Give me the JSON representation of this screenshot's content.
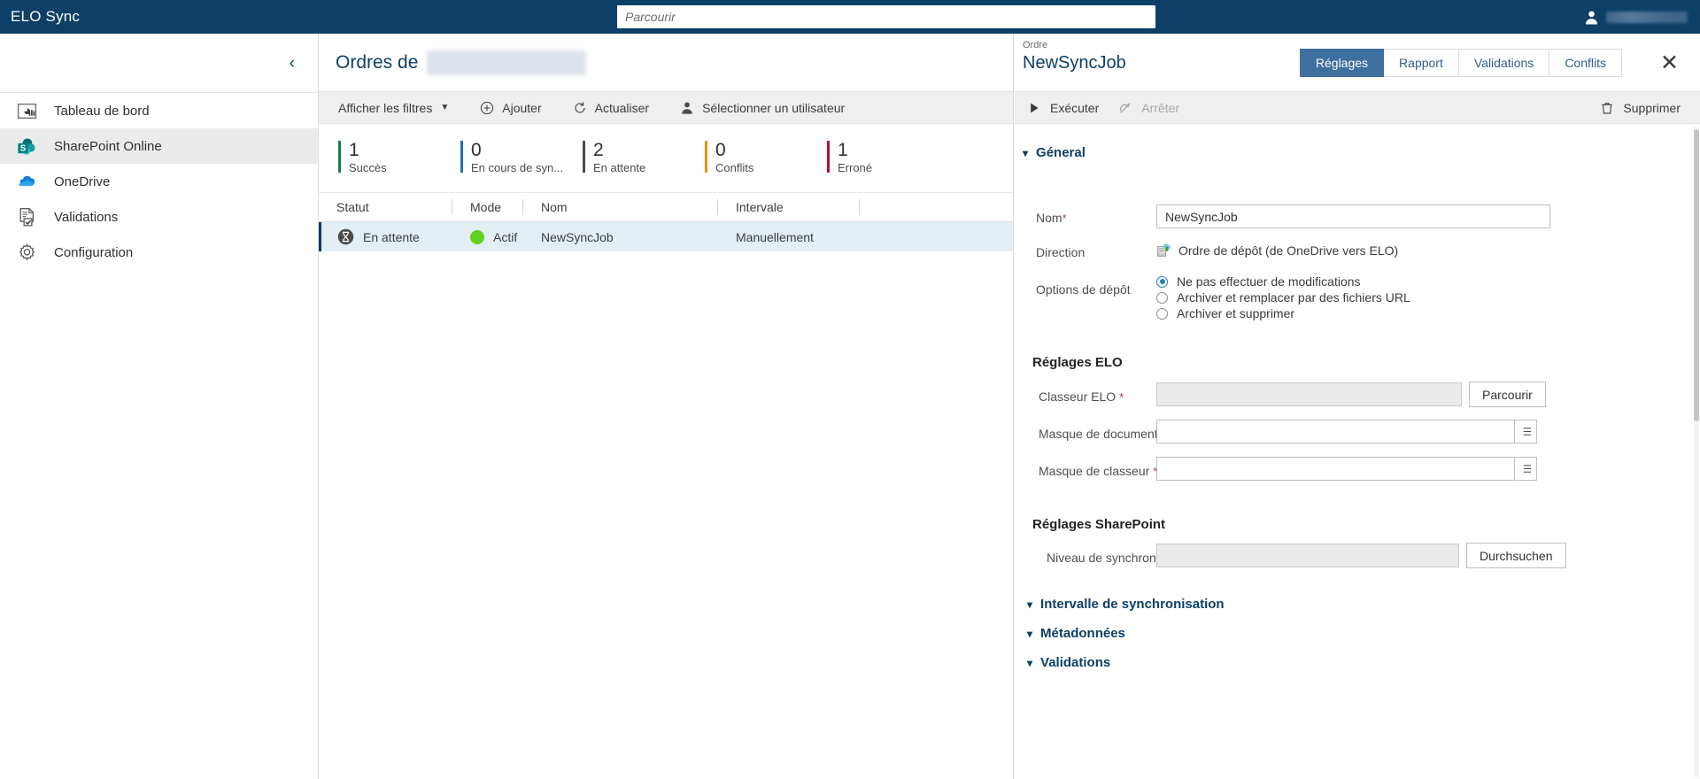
{
  "topbar": {
    "app_title": "ELO Sync",
    "search_placeholder": "Parcourir",
    "search_value": "",
    "user_icon": "user-icon"
  },
  "sidebar": {
    "collapse_icon": "chevron-left-icon",
    "items": [
      {
        "label": "Tableau de bord",
        "icon": "dashboard-icon",
        "active": false
      },
      {
        "label": "SharePoint Online",
        "icon": "sharepoint-icon",
        "active": true
      },
      {
        "label": "OneDrive",
        "icon": "onedrive-icon",
        "active": false
      },
      {
        "label": "Validations",
        "icon": "document-check-icon",
        "active": false
      },
      {
        "label": "Configuration",
        "icon": "gear-icon",
        "active": false
      }
    ]
  },
  "center": {
    "title": "Ordres de",
    "toolbar": {
      "filters_label": "Afficher les filtres",
      "add_label": "Ajouter",
      "refresh_label": "Actualiser",
      "select_user_label": "Sélectionner un utilisateur"
    },
    "stats": [
      {
        "value": "1",
        "label": "Succès",
        "color": "#1f7a4d"
      },
      {
        "value": "0",
        "label": "En cours de syn...",
        "color": "#1f6fb5"
      },
      {
        "value": "2",
        "label": "En attente",
        "color": "#4a4a4a"
      },
      {
        "value": "0",
        "label": "Conflits",
        "color": "#e8960c"
      },
      {
        "value": "1",
        "label": "Erroné",
        "color": "#b1123a"
      }
    ],
    "table": {
      "columns": [
        "Statut",
        "Mode",
        "Nom",
        "Intervale",
        ""
      ],
      "rows": [
        {
          "statut": "En attente",
          "statut_icon": "hourglass-icon",
          "mode": "Actif",
          "mode_icon": "green-dot-icon",
          "nom": "NewSyncJob",
          "intervale": "Manuellement",
          "selected": true
        }
      ]
    }
  },
  "detail": {
    "kicker": "Ordre",
    "title": "NewSyncJob",
    "close_label": "✕",
    "tabs": [
      {
        "label": "Réglages",
        "active": true
      },
      {
        "label": "Rapport",
        "active": false
      },
      {
        "label": "Validations",
        "active": false
      },
      {
        "label": "Conflits",
        "active": false
      }
    ],
    "toolbar": {
      "run_label": "Exécuter",
      "run_icon": "play-icon",
      "stop_label": "Arrêter",
      "stop_icon": "stop-sync-icon",
      "delete_label": "Supprimer",
      "delete_icon": "trash-icon"
    },
    "general": {
      "section_label": "Géneral",
      "nom_label": "Nom",
      "nom_value": "NewSyncJob",
      "nom_required": "*",
      "direction_label": "Direction",
      "direction_value": "Ordre de dépôt (de OneDrive vers ELO)",
      "direction_icon": "elo-import-icon",
      "options_label": "Options de dépôt",
      "options": [
        {
          "label": "Ne pas effectuer de modifications",
          "selected": true
        },
        {
          "label": "Archiver et remplacer par des fichiers URL",
          "selected": false
        },
        {
          "label": "Archiver et supprimer",
          "selected": false
        }
      ]
    },
    "elo_settings": {
      "section_label": "Réglages ELO",
      "fields": [
        {
          "label": "Classeur ELO",
          "required": "*",
          "value": "",
          "readonly": true,
          "button": "Parcourir",
          "icon_button": null
        },
        {
          "label": "Masque de document",
          "required": "*",
          "value": "",
          "readonly": false,
          "button": null,
          "icon_button": "list-icon"
        },
        {
          "label": "Masque de classeur",
          "required": "*",
          "value": "",
          "readonly": false,
          "button": null,
          "icon_button": "list-icon"
        }
      ]
    },
    "sharepoint_settings": {
      "section_label": "Réglages SharePoint",
      "fields": [
        {
          "label": "Niveau de synchronisation",
          "required": "*",
          "value": "",
          "readonly": true,
          "button": "Durchsuchen"
        }
      ]
    },
    "collapsed_sections": [
      {
        "label": "Intervalle de synchronisation"
      },
      {
        "label": "Métadonnées"
      },
      {
        "label": "Validations"
      }
    ]
  },
  "colors": {
    "brand_dark": "#0d3f67",
    "tab_active": "#3f6f9e",
    "row_selected": "#e3eef5",
    "toolbar_bg": "#efefef"
  }
}
